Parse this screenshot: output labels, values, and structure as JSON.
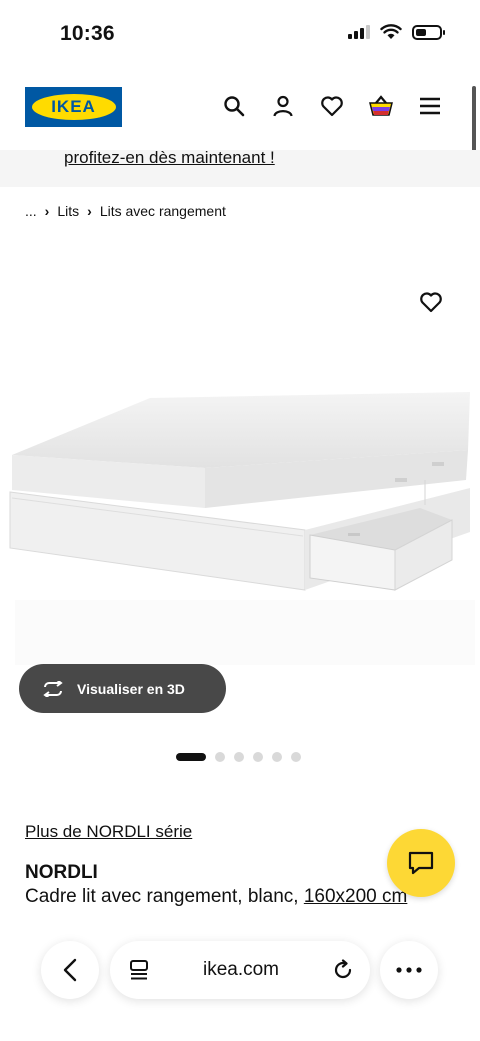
{
  "status_bar": {
    "time": "10:36",
    "signal": "signal-icon",
    "wifi": "wifi-icon",
    "battery": "battery-icon"
  },
  "header": {
    "logo_text": "IKEA",
    "icons": [
      "search-icon",
      "account-icon",
      "heart-icon",
      "basket-icon",
      "menu-icon"
    ],
    "colors": {
      "brand_blue": "#0058a3",
      "brand_yellow": "#ffdb00"
    }
  },
  "promo": {
    "link_text": "profitez-en dès maintenant !"
  },
  "breadcrumb": {
    "ellipsis": "...",
    "items": [
      "Lits",
      "Lits avec rangement"
    ]
  },
  "gallery": {
    "visualize_label": "Visualiser en 3D",
    "dots_count": 6,
    "active_dot": 0
  },
  "product": {
    "series_link": "Plus de NORDLI série",
    "name": "NORDLI",
    "description": "Cadre lit avec rangement, blanc,",
    "size": "160x200 cm"
  },
  "chat": {
    "icon": "chat-icon",
    "color": "#fdd835"
  },
  "browser_bar": {
    "url": "ikea.com",
    "icons": [
      "back-icon",
      "tabs-icon",
      "reload-icon",
      "more-icon"
    ]
  }
}
